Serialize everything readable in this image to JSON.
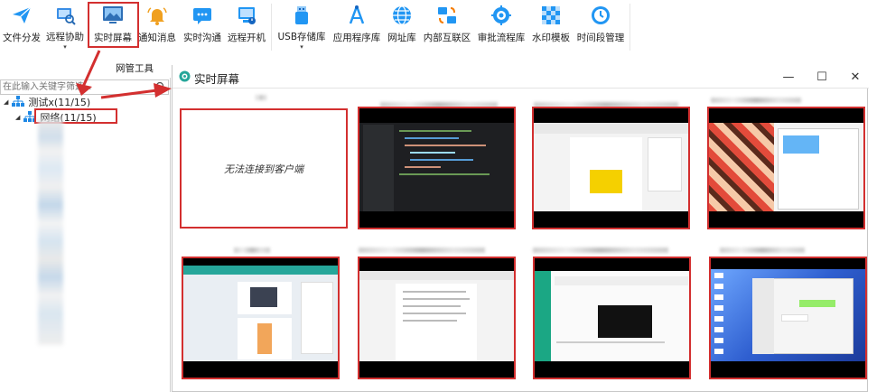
{
  "toolbar": {
    "items": [
      {
        "label": "文件分发",
        "icon": "send-icon",
        "color": "#2196f3"
      },
      {
        "label": "远程协助",
        "icon": "remote-assist-icon",
        "color": "#3a8ee6",
        "dropdown": "▾"
      },
      {
        "label": "实时屏幕",
        "icon": "realtime-screen-icon",
        "color": "#2e6fb6"
      },
      {
        "label": "通知消息",
        "icon": "bell-icon",
        "color": "#f0a020"
      },
      {
        "label": "实时沟通",
        "icon": "chat-icon",
        "color": "#2196f3"
      },
      {
        "label": "远程开机",
        "icon": "power-on-icon",
        "color": "#2196f3"
      },
      {
        "label": "USB存储库",
        "icon": "usb-icon",
        "color": "#2196f3",
        "dropdown": "▾"
      },
      {
        "label": "应用程序库",
        "icon": "app-library-icon",
        "color": "#2196f3"
      },
      {
        "label": "网址库",
        "icon": "globe-icon",
        "color": "#2196f3"
      },
      {
        "label": "内部互联区",
        "icon": "network-icon",
        "color": "#2196f3"
      },
      {
        "label": "审批流程库",
        "icon": "approval-icon",
        "color": "#2196f3"
      },
      {
        "label": "水印模板",
        "icon": "watermark-icon",
        "color": "#2196f3"
      },
      {
        "label": "时间段管理",
        "icon": "clock-icon",
        "color": "#2196f3"
      }
    ],
    "group_label": "网管工具"
  },
  "sidebar": {
    "search_placeholder": "在此输入关键字筛选...",
    "root": {
      "label": "测试x(11/15)"
    },
    "child": {
      "label": "网络(11/15)"
    }
  },
  "window": {
    "title": "实时屏幕",
    "minimize": "—",
    "maximize": "☐",
    "close": "✕"
  },
  "screens": [
    {
      "status": "offline",
      "message": "无法连接到客户端"
    },
    {
      "status": "online",
      "kind": "ide"
    },
    {
      "status": "online",
      "kind": "document"
    },
    {
      "status": "online",
      "kind": "desktop-images"
    },
    {
      "status": "online",
      "kind": "document-images"
    },
    {
      "status": "online",
      "kind": "document"
    },
    {
      "status": "online",
      "kind": "web-app"
    },
    {
      "status": "online",
      "kind": "desktop-chat"
    }
  ],
  "colors": {
    "highlight": "#d32f2f",
    "accent": "#1e88e5"
  }
}
